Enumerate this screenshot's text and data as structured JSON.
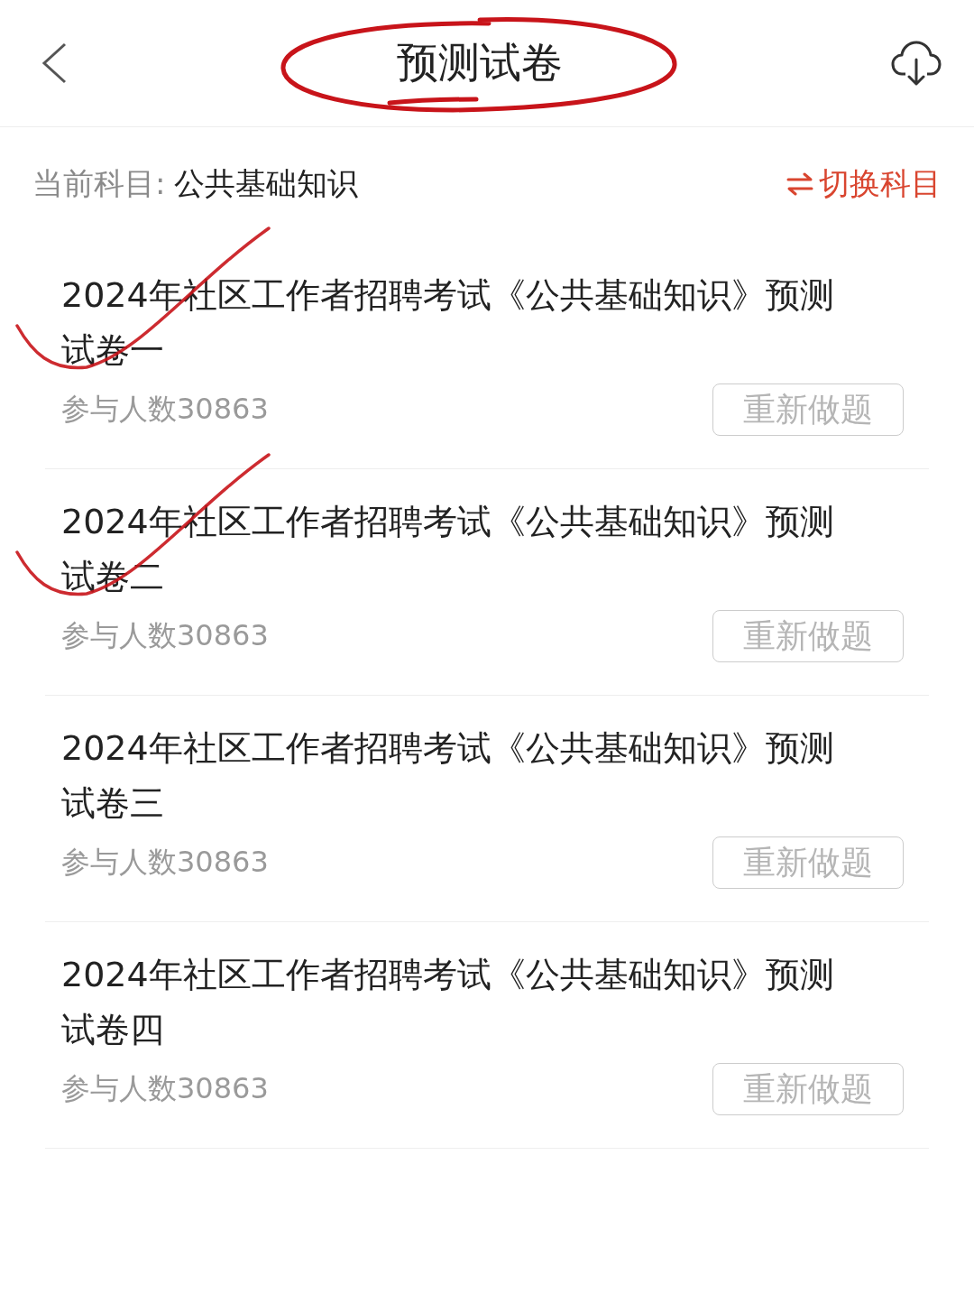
{
  "header": {
    "title": "预测试卷",
    "title_circled": true
  },
  "subject": {
    "label": "当前科目:",
    "value": "公共基础知识",
    "switch": "切换科目"
  },
  "papers": [
    {
      "title": "2024年社区工作者招聘考试《公共基础知识》预测试卷一",
      "participants": "参与人数30863",
      "button": "重新做题",
      "ticked": true
    },
    {
      "title": "2024年社区工作者招聘考试《公共基础知识》预测试卷二",
      "participants": "参与人数30863",
      "button": "重新做题",
      "ticked": true
    },
    {
      "title": "2024年社区工作者招聘考试《公共基础知识》预测试卷三",
      "participants": "参与人数30863",
      "button": "重新做题",
      "ticked": false
    },
    {
      "title": "2024年社区工作者招聘考试《公共基础知识》预测试卷四",
      "participants": "参与人数30863",
      "button": "重新做题",
      "ticked": false
    }
  ]
}
